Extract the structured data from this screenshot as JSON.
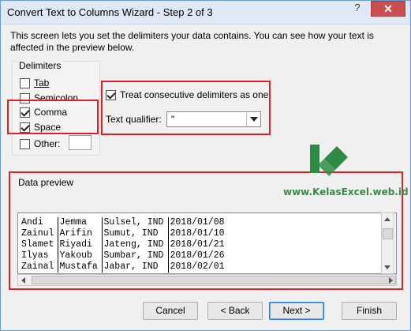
{
  "window": {
    "title": "Convert Text to Columns Wizard - Step 2 of 3",
    "help_glyph": "?",
    "close_glyph": "✕"
  },
  "intro_text": "This screen lets you set the delimiters your data contains.  You can see how your text is affected in the preview below.",
  "delimiters": {
    "group_label": "Delimiters",
    "items": [
      {
        "label": "Tab",
        "checked": false
      },
      {
        "label": "Semicolon",
        "checked": false
      },
      {
        "label": "Comma",
        "checked": true
      },
      {
        "label": "Space",
        "checked": true
      },
      {
        "label": "Other:",
        "checked": false
      }
    ],
    "other_value": ""
  },
  "consecutive": {
    "label": "Treat consecutive delimiters as one",
    "checked": true
  },
  "qualifier": {
    "label": "Text qualifier:",
    "value": "\""
  },
  "watermark": {
    "url": "www.KelasExcel.web.id",
    "color": "#3a8a4a"
  },
  "preview": {
    "label": "Data preview",
    "rows": [
      [
        "Andi",
        "Jemma",
        "Sulsel, IND",
        "2018/01/08"
      ],
      [
        "Zainul",
        "Arifin",
        "Sumut, IND",
        "2018/01/10"
      ],
      [
        "Slamet",
        "Riyadi",
        "Jateng, IND",
        "2018/01/21"
      ],
      [
        "Ilyas",
        "Yakoub",
        "Sumbar, IND",
        "2018/01/26"
      ],
      [
        "Zainal",
        "Mustafa",
        "Jabar, IND",
        "2018/02/01"
      ]
    ]
  },
  "buttons": {
    "cancel": "Cancel",
    "back": "< Back",
    "next": "Next >",
    "finish": "Finish"
  },
  "colors": {
    "highlight": "#e0202a",
    "close": "#c75050",
    "logo_green": "#2e8b45"
  }
}
